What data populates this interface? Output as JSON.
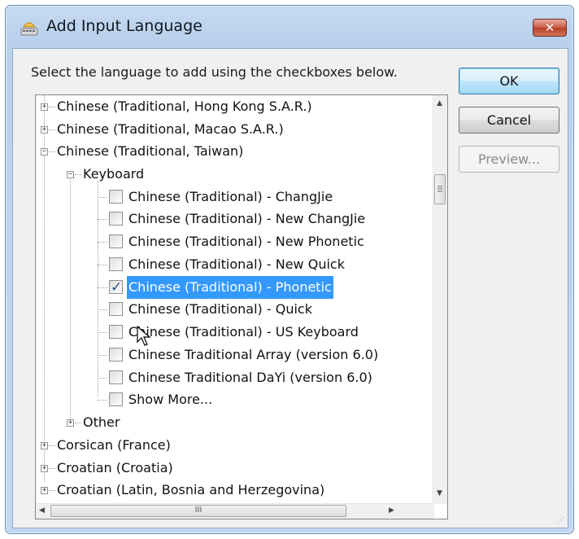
{
  "window": {
    "title": "Add Input Language",
    "icon": "keyboard-language-icon",
    "close_glyph": "✕"
  },
  "prompt": "Select the language to add using the checkboxes below.",
  "buttons": {
    "ok": "OK",
    "cancel": "Cancel",
    "preview": "Preview..."
  },
  "tree": {
    "languages": [
      {
        "label": "Chinese (Traditional, Hong Kong S.A.R.)",
        "expanded": false
      },
      {
        "label": "Chinese (Traditional, Macao S.A.R.)",
        "expanded": false
      },
      {
        "label": "Chinese (Traditional, Taiwan)",
        "expanded": true
      }
    ],
    "keyboard_group": "Keyboard",
    "keyboards": [
      {
        "label": "Chinese (Traditional) - ChangJie",
        "checked": false,
        "selected": false
      },
      {
        "label": "Chinese (Traditional) - New ChangJie",
        "checked": false,
        "selected": false
      },
      {
        "label": "Chinese (Traditional) - New Phonetic",
        "checked": false,
        "selected": false
      },
      {
        "label": "Chinese (Traditional) - New Quick",
        "checked": false,
        "selected": false
      },
      {
        "label": "Chinese (Traditional) - Phonetic",
        "checked": true,
        "selected": true
      },
      {
        "label": "Chinese (Traditional) - Quick",
        "checked": false,
        "selected": false
      },
      {
        "label": "Chinese (Traditional) - US Keyboard",
        "checked": false,
        "selected": false
      },
      {
        "label": "Chinese Traditional Array (version 6.0)",
        "checked": false,
        "selected": false
      },
      {
        "label": "Chinese Traditional DaYi (version 6.0)",
        "checked": false,
        "selected": false
      },
      {
        "label": "Show More...",
        "checked": false,
        "selected": false
      }
    ],
    "other_group": "Other",
    "more_languages": [
      {
        "label": "Corsican (France)"
      },
      {
        "label": "Croatian (Croatia)"
      },
      {
        "label": "Croatian (Latin, Bosnia and Herzegovina)"
      }
    ]
  },
  "scrollbars": {
    "hthumb_grip": "III"
  }
}
